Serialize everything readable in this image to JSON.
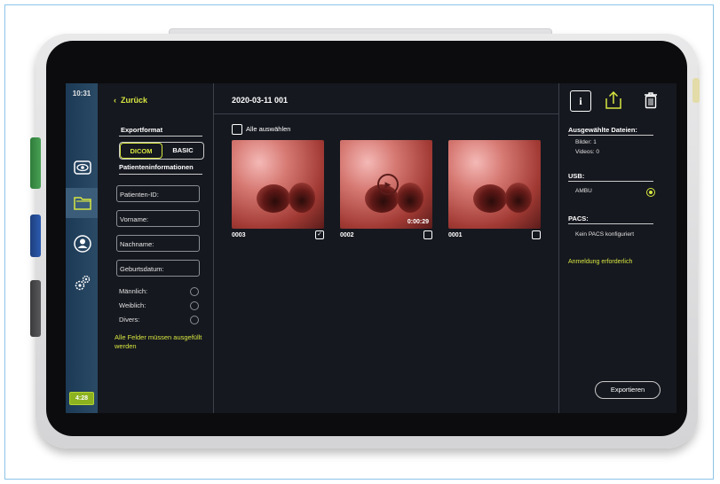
{
  "colors": {
    "accent": "#d8e640",
    "screen_bg": "#15181f",
    "rail_bg": "#2a4a66",
    "text": "#ffffff"
  },
  "status": {
    "time": "10:31",
    "battery": "4:28"
  },
  "rail": {
    "icons": [
      "eye-icon",
      "folder-icon",
      "patient-icon",
      "settings-icon"
    ],
    "active_index": 1
  },
  "left": {
    "back_label": "Zurück",
    "export_format_title": "Exportformat",
    "format_options": [
      "DICOM",
      "BASIC"
    ],
    "selected_format": "DICOM",
    "patient_info_title": "Patienteninformationen",
    "fields": {
      "patient_id": "Patienten-ID:",
      "first_name": "Vorname:",
      "last_name": "Nachname:",
      "birth_date": "Geburtsdatum:"
    },
    "gender_options": [
      "Männlich:",
      "Weiblich:",
      "Divers:"
    ],
    "warning": "Alle Felder müssen ausgefüllt werden"
  },
  "main": {
    "title": "2020-03-11 001",
    "select_all_label": "Alle auswählen",
    "thumbnails": [
      {
        "label": "0003",
        "checked": true,
        "is_video": false,
        "duration": ""
      },
      {
        "label": "0002",
        "checked": false,
        "is_video": true,
        "duration": "0:00:29"
      },
      {
        "label": "0001",
        "checked": false,
        "is_video": false,
        "duration": ""
      }
    ]
  },
  "right": {
    "selected_files_title": "Ausgewählte Dateien:",
    "images_count": "Bilder: 1",
    "videos_count": "Videos: 0",
    "usb_title": "USB:",
    "usb_device": "AMBU",
    "pacs_title": "PACS:",
    "pacs_status": "Kein PACS konfiguriert",
    "login_required": "Anmeldung erforderlich",
    "export_button": "Exportieren",
    "top_icons": [
      "info-icon",
      "upload-icon",
      "trash-icon"
    ]
  }
}
